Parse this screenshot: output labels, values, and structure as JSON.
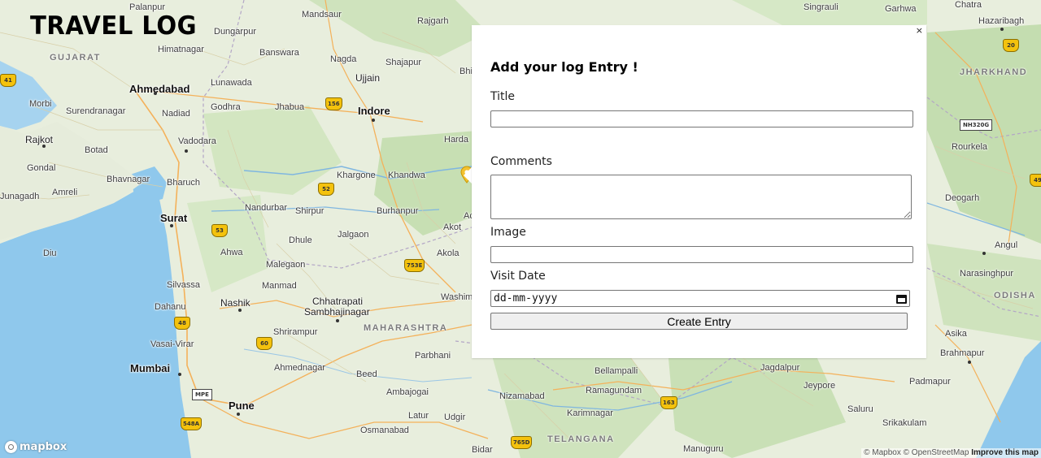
{
  "app": {
    "title": "TRAVEL LOG"
  },
  "map": {
    "regions": [
      "GUJARAT",
      "MAHARASHTRA",
      "TELANGANA",
      "JHARKHAND",
      "ODISHA"
    ],
    "cities": [
      "Palanpur",
      "Mandsaur",
      "Rajgarh",
      "Singrauli",
      "Garhwa",
      "Chatra",
      "Hazaribagh",
      "Himatnagar",
      "Dungarpur",
      "Banswara",
      "Nagda",
      "Shajapur",
      "Ahmedabad",
      "Lunawada",
      "Ujjain",
      "Morbi",
      "Surendranagar",
      "Nadiad",
      "Godhra",
      "Jhabua",
      "Indore",
      "Rajkot",
      "Botad",
      "Vadodara",
      "Harda",
      "Gondal",
      "Bhavnagar",
      "Bharuch",
      "Khargone",
      "Khandwa",
      "Junagadh",
      "Amreli",
      "Surat",
      "Nandurbar",
      "Shirpur",
      "Burhanpur",
      "Dhule",
      "Jalgaon",
      "Akot",
      "Diu",
      "Ahwa",
      "Malegaon",
      "Akola",
      "Silvassa",
      "Manmad",
      "Dahanu",
      "Nashik",
      "Chhatrapati",
      "Sambhajinagar",
      "Washim",
      "Shrirampur",
      "Vasai-Virar",
      "Mumbai",
      "Ahmednagar",
      "Parbhani",
      "Beed",
      "Bellampalli",
      "Jagdalpur",
      "Pune",
      "Ambajogai",
      "Nizamabad",
      "Ramagundam",
      "Karimnagar",
      "Latur",
      "Udgir",
      "Osmanabad",
      "Bidar",
      "Manuguru",
      "Rourkela",
      "Deogarh",
      "Angul",
      "Narasinghpur",
      "Asika",
      "Brahmapur",
      "Jeypore",
      "Padmapur",
      "Srikakulam",
      "Saluru",
      "Jhabua",
      "Bhi",
      "Ac"
    ],
    "shields": [
      "41",
      "156",
      "52",
      "53",
      "753E",
      "48",
      "60",
      "MPE",
      "548A",
      "163",
      "765D",
      "20",
      "49",
      "NH320G"
    ]
  },
  "attribution": {
    "logo_text": "mapbox",
    "copyright_mapbox": "© Mapbox",
    "copyright_osm": "© OpenStreetMap",
    "improve_link": "Improve this map"
  },
  "form": {
    "close_label": "×",
    "heading": "Add your log Entry !",
    "title_label": "Title",
    "title_value": "",
    "comments_label": "Comments",
    "comments_value": "",
    "image_label": "Image",
    "image_value": "",
    "visit_date_label": "Visit Date",
    "visit_date_placeholder": "dd-mm-yyyy",
    "submit_label": "Create Entry"
  },
  "colors": {
    "map_land": "#e9efe1",
    "sea": "#8cc7ec",
    "highway_shield": "#f4c20d",
    "popup_bg": "#ffffff",
    "button_bg": "#efefef"
  }
}
